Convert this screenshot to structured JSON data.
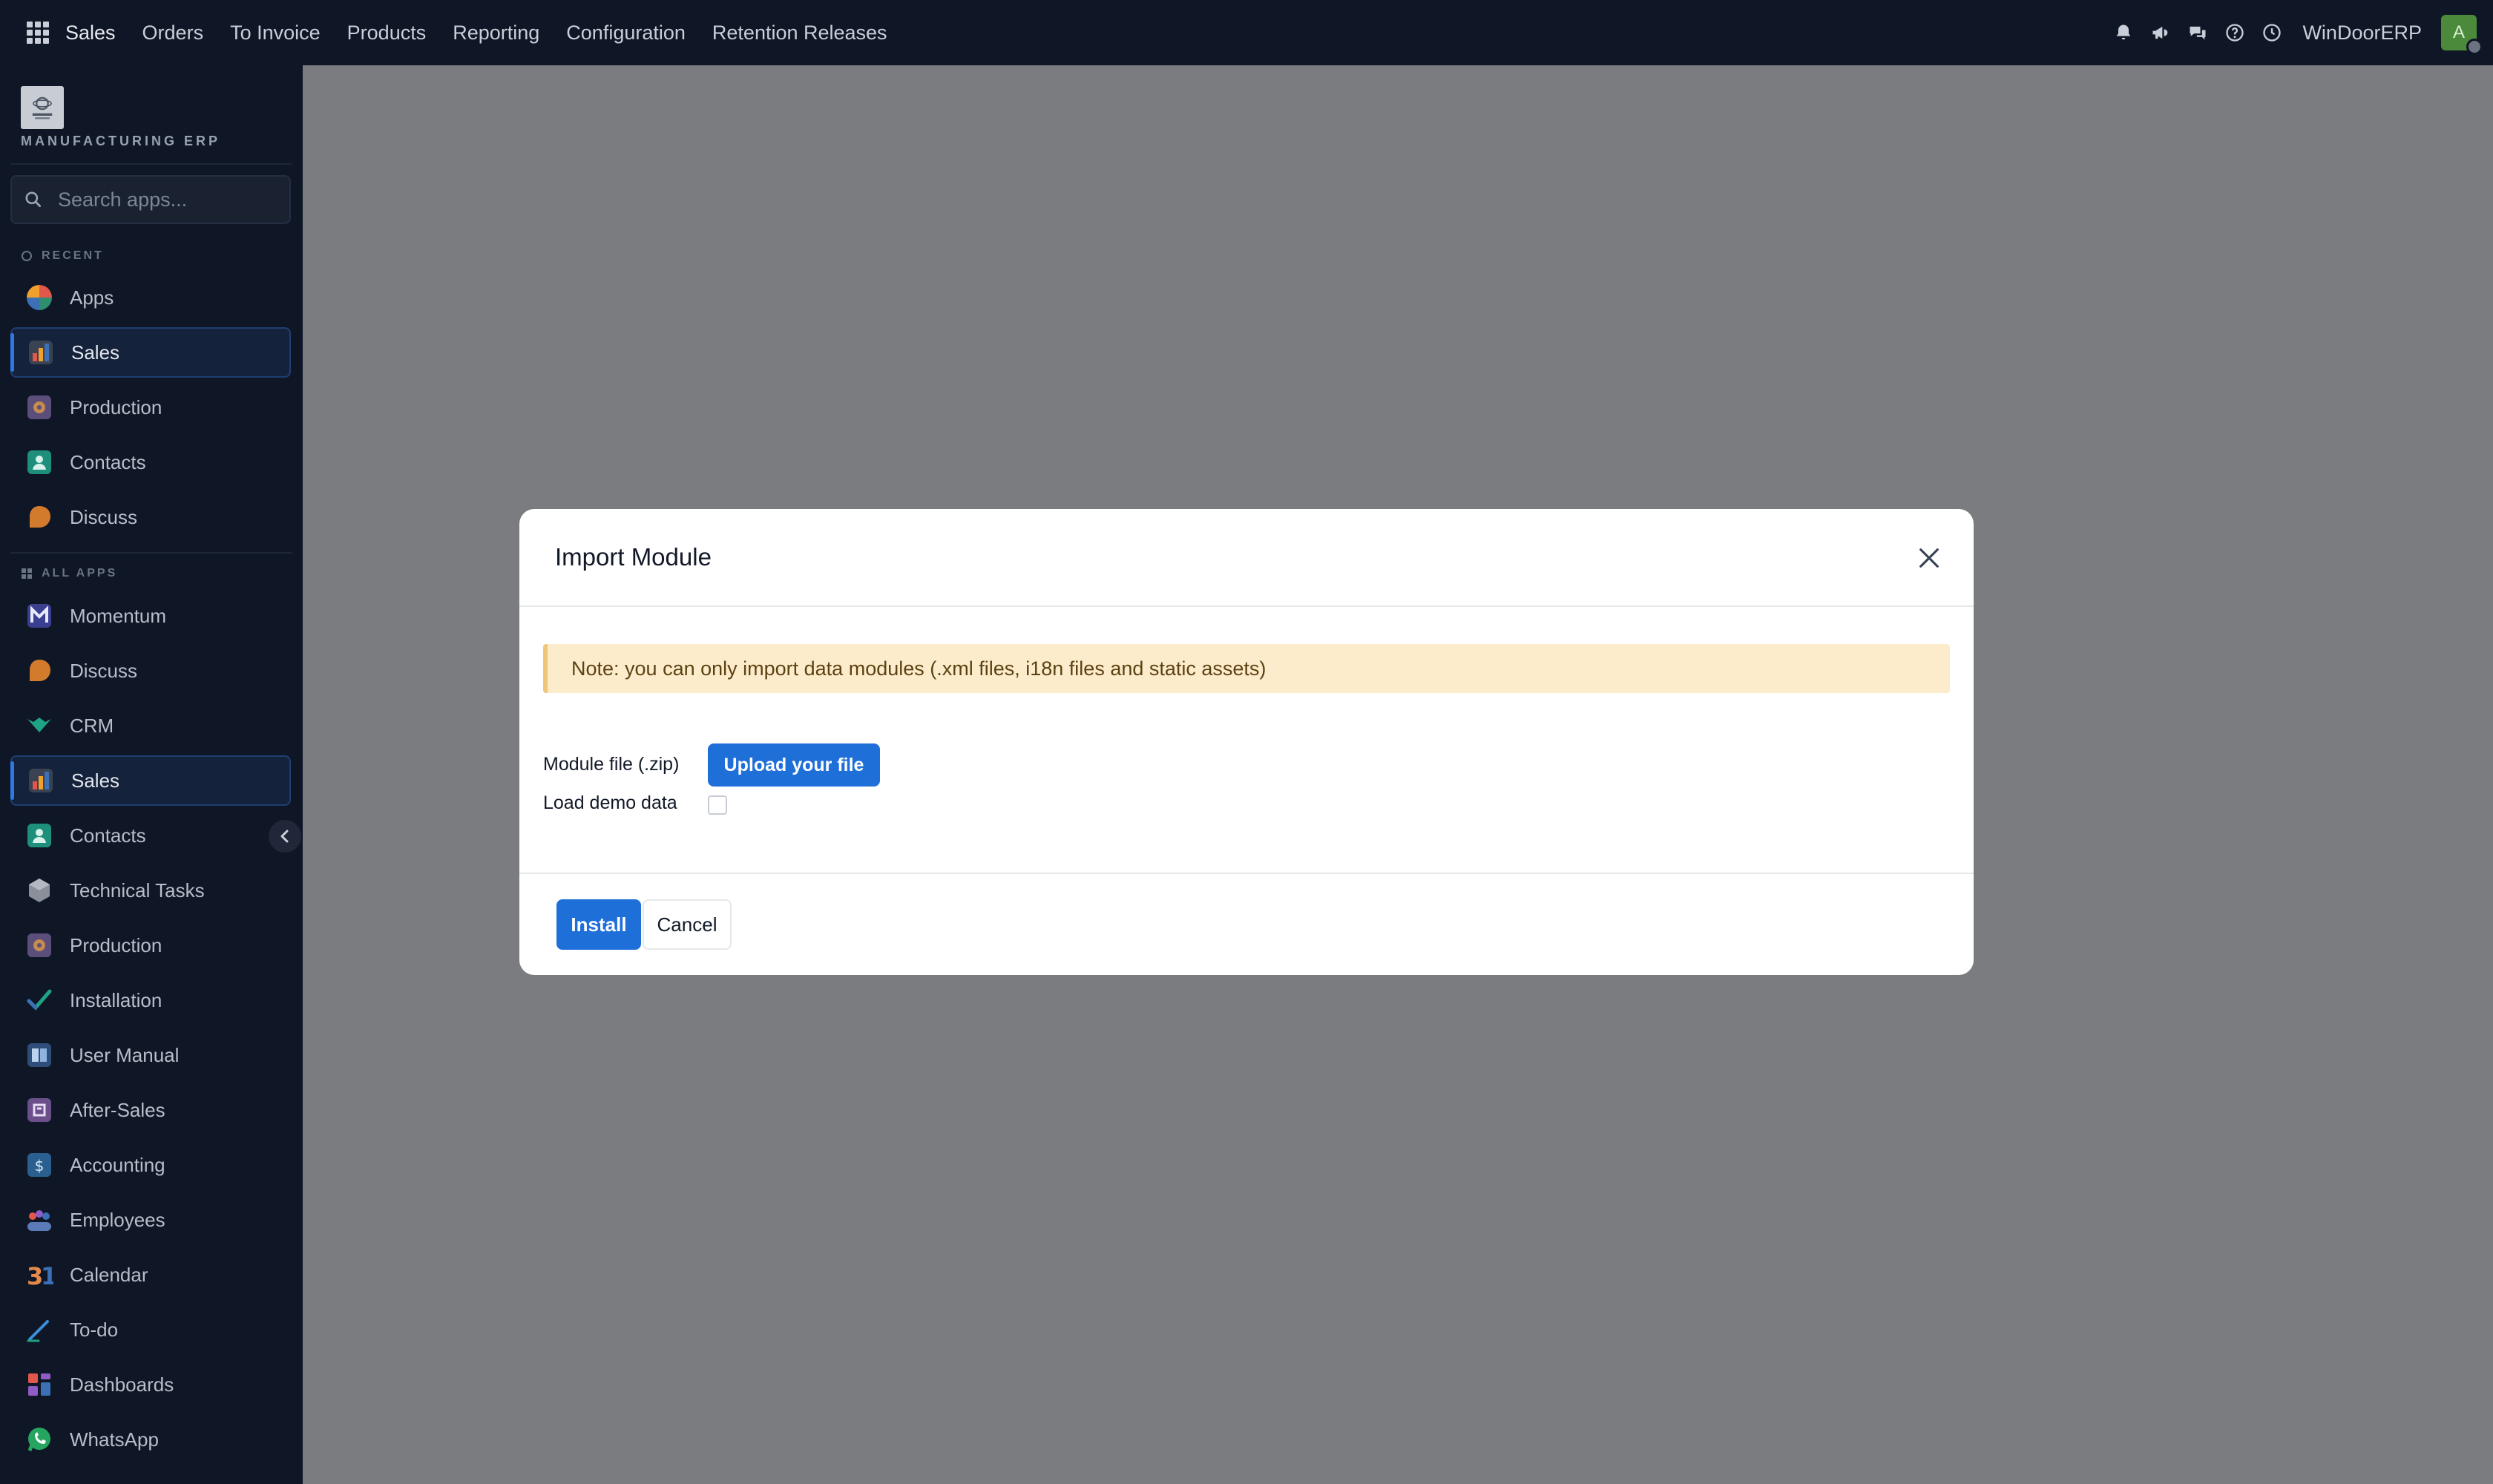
{
  "topbar": {
    "menu": [
      {
        "label": "Sales",
        "brand": true
      },
      {
        "label": "Orders"
      },
      {
        "label": "To Invoice"
      },
      {
        "label": "Products"
      },
      {
        "label": "Reporting"
      },
      {
        "label": "Configuration"
      },
      {
        "label": "Retention Releases"
      }
    ],
    "company": "WinDoorERP",
    "avatar_initial": "A",
    "icons": [
      "bell-icon",
      "megaphone-icon",
      "chat-icon",
      "help-icon",
      "clock-icon"
    ]
  },
  "sidebar": {
    "logo_text": "MANUFACTURING ERP",
    "search_placeholder": "Search apps...",
    "recent_title": "RECENT",
    "all_apps_title": "ALL APPS",
    "recent": [
      {
        "label": "Apps",
        "icon": "apps",
        "active": false
      },
      {
        "label": "Sales",
        "icon": "sales",
        "active": true
      },
      {
        "label": "Production",
        "icon": "production",
        "active": false
      },
      {
        "label": "Contacts",
        "icon": "contacts",
        "active": false
      },
      {
        "label": "Discuss",
        "icon": "discuss",
        "active": false
      }
    ],
    "all_apps": [
      {
        "label": "Momentum",
        "icon": "momentum",
        "active": false
      },
      {
        "label": "Discuss",
        "icon": "discuss",
        "active": false
      },
      {
        "label": "CRM",
        "icon": "crm",
        "active": false
      },
      {
        "label": "Sales",
        "icon": "sales",
        "active": true
      },
      {
        "label": "Contacts",
        "icon": "contacts",
        "active": false
      },
      {
        "label": "Technical Tasks",
        "icon": "technical",
        "active": false
      },
      {
        "label": "Production",
        "icon": "production",
        "active": false
      },
      {
        "label": "Installation",
        "icon": "installation",
        "active": false
      },
      {
        "label": "User Manual",
        "icon": "manual",
        "active": false
      },
      {
        "label": "After-Sales",
        "icon": "aftersales",
        "active": false
      },
      {
        "label": "Accounting",
        "icon": "accounting",
        "active": false
      },
      {
        "label": "Employees",
        "icon": "employees",
        "active": false
      },
      {
        "label": "Calendar",
        "icon": "calendar",
        "active": false
      },
      {
        "label": "To-do",
        "icon": "todo",
        "active": false
      },
      {
        "label": "Dashboards",
        "icon": "dashboards",
        "active": false
      },
      {
        "label": "WhatsApp",
        "icon": "whatsapp",
        "active": false
      }
    ]
  },
  "modal": {
    "title": "Import Module",
    "note": "Note: you can only import data modules (.xml files, i18n files and static assets)",
    "module_file_label": "Module file (.zip)",
    "upload_label": "Upload your file",
    "demo_label": "Load demo data",
    "demo_checked": false,
    "install_label": "Install",
    "cancel_label": "Cancel"
  },
  "colors": {
    "navbar": "#0f1626",
    "backdrop": "#7b7c7f",
    "primary": "#1f6fd8",
    "note_bg": "#fdeccc",
    "note_border": "#f0c777"
  }
}
